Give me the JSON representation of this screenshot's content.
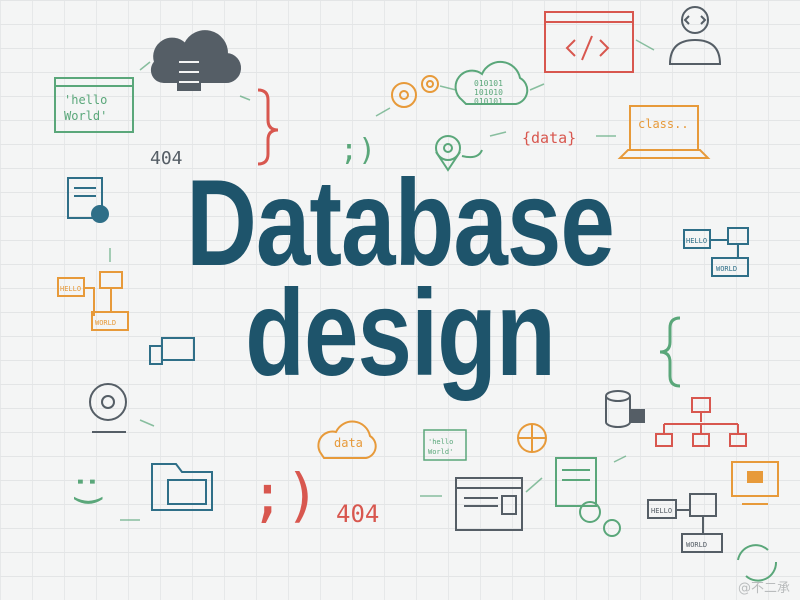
{
  "headline": {
    "line1": "Database",
    "line2": "design"
  },
  "labels": {
    "hello_world_top": [
      "'hello",
      "World'"
    ],
    "hello_world_bottom": [
      "'hello",
      "World'"
    ],
    "code_404_top": "404",
    "code_404_bottom": "404",
    "data_top": "{data}",
    "data_bottom": "data",
    "class_text": "class..",
    "binary_lines": [
      "010101",
      "101010",
      "010101"
    ],
    "hello_top_right": "HELLO",
    "world_top_right": "WORLD",
    "hello_left": "HELLO",
    "world_left": "WORLD",
    "hello_bottom_right": "HELLO",
    "world_bottom_right": "WORLD",
    "semicolon_paren_top": ";)",
    "semicolon_paren_big": ";)",
    "smile_left": ":)"
  },
  "watermark": "@不二承",
  "colors": {
    "headline": "#1e546b",
    "green": "#5aa77a",
    "red": "#d8574f",
    "orange": "#e79a3a",
    "teal": "#2f6f88",
    "gray": "#555e66"
  }
}
